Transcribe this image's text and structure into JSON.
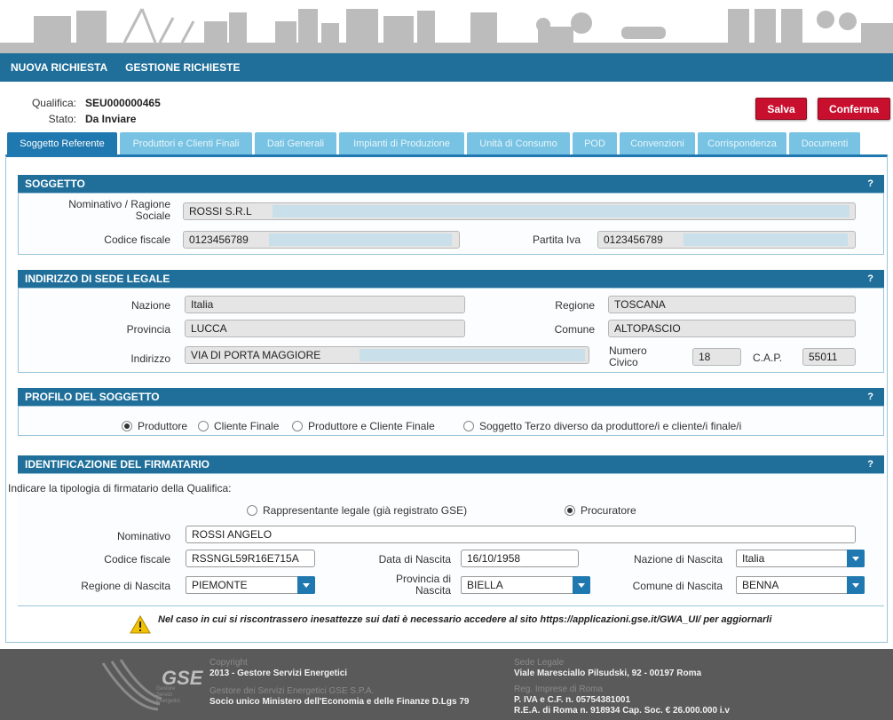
{
  "nav": {
    "new_request": "NUOVA RICHIESTA",
    "manage_requests": "GESTIONE RICHIESTE"
  },
  "qualifica": {
    "qualifica_label": "Qualifica:",
    "qualifica_value": "SEU000000465",
    "stato_label": "Stato:",
    "stato_value": "Da Inviare"
  },
  "actions": {
    "save": "Salva",
    "confirm": "Conferma"
  },
  "tabs": [
    "Soggetto Referente",
    "Produttori e Clienti Finali",
    "Dati Generali",
    "Impianti di Produzione",
    "Unità di Consumo",
    "POD",
    "Convenzioni",
    "Corrispondenza",
    "Documenti"
  ],
  "help": "?",
  "soggetto": {
    "title": "SOGGETTO",
    "nominativo_label": "Nominativo / Ragione Sociale",
    "nominativo_value": "ROSSI S.R.L",
    "cf_label": "Codice fiscale",
    "cf_value": "0123456789",
    "piva_label": "Partita Iva",
    "piva_value": "0123456789"
  },
  "indirizzo": {
    "title": "INDIRIZZO DI SEDE LEGALE",
    "nazione_label": "Nazione",
    "nazione_value": "Italia",
    "regione_label": "Regione",
    "regione_value": "TOSCANA",
    "provincia_label": "Provincia",
    "provincia_value": "LUCCA",
    "comune_label": "Comune",
    "comune_value": "ALTOPASCIO",
    "indirizzo_label": "Indirizzo",
    "indirizzo_value": "VIA DI PORTA MAGGIORE",
    "civico_label": "Numero Civico",
    "civico_value": "18",
    "cap_label": "C.A.P.",
    "cap_value": "55011"
  },
  "profilo": {
    "title": "PROFILO DEL SOGGETTO",
    "options": [
      "Produttore",
      "Cliente Finale",
      "Produttore e Cliente Finale",
      "Soggetto Terzo diverso da produttore/i e cliente/i finale/i"
    ],
    "selected": 0
  },
  "firmatario": {
    "title": "IDENTIFICAZIONE DEL FIRMATARIO",
    "intro": "Indicare la tipologia di firmatario della Qualifica:",
    "opt_rappresentante": "Rappresentante legale (già registrato GSE)",
    "opt_procuratore": "Procuratore",
    "selected": "Procuratore",
    "nominativo_label": "Nominativo",
    "nominativo_value": "ROSSI ANGELO",
    "cf_label": "Codice fiscale",
    "cf_value": "RSSNGL59R16E715A",
    "data_label": "Data di Nascita",
    "data_value": "16/10/1958",
    "nazione_label": "Nazione di Nascita",
    "nazione_value": "Italia",
    "regione_label": "Regione di Nascita",
    "regione_value": "PIEMONTE",
    "provincia_label": "Provincia di Nascita",
    "provincia_value": "BIELLA",
    "comune_label": "Comune di Nascita",
    "comune_value": "BENNA"
  },
  "warning": {
    "text": "Nel caso in cui si riscontrassero inesattezze sui dati è necessario accedere al sito https://applicazioni.gse.it/GWA_UI/ per aggiornarli"
  },
  "footer": {
    "logo": "GSE",
    "logo_sub": "Gestore Servizi Energetici",
    "copyright_h": "Copyright",
    "copyright": "2013 - Gestore Servizi Energetici",
    "company_h": "Gestore dei Servizi Energetici GSE S.P.A.",
    "company": "Socio unico Ministero dell'Economia e delle Finanze D.Lgs 79",
    "sede_h": "Sede Legale",
    "sede": "Viale Maresciallo Pilsudski, 92 - 00197 Roma",
    "reg_h": "Reg. Imprese di Roma",
    "reg1": "P. IVA e C.F. n. 05754381001",
    "reg2": "R.E.A. di Roma n. 918934 Cap. Soc. € 26.000.000 i.v"
  },
  "colors": {
    "nav": "#1f6f9a",
    "tab_active": "#1f78b0",
    "tab": "#78c3e3",
    "button_red": "#c8102e",
    "footer": "#5a5a5a"
  }
}
